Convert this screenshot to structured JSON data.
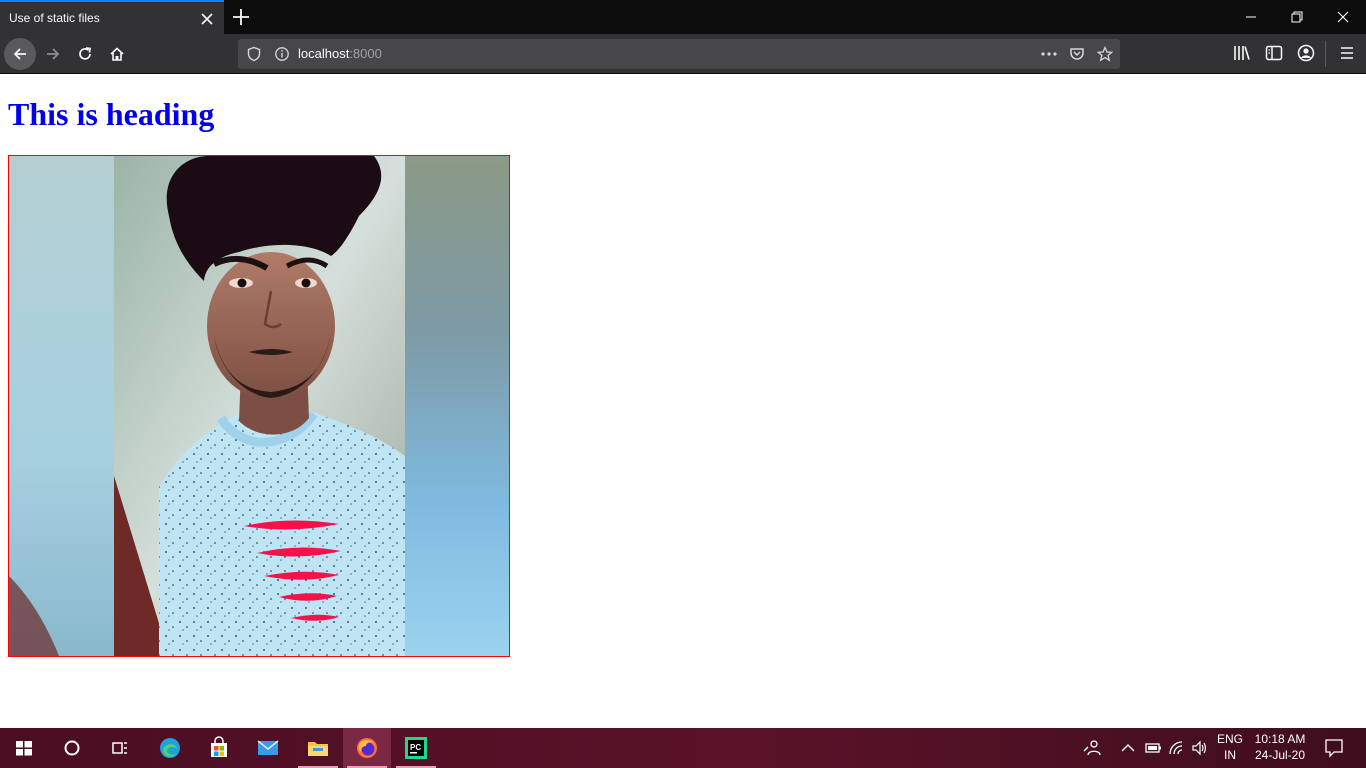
{
  "browser": {
    "tab_title": "Use of static files",
    "url_host": "localhost",
    "url_port": ":8000",
    "accent_color": "#0a84ff"
  },
  "page": {
    "heading": "This is heading",
    "heading_color": "#0000ee",
    "image_border_color": "#ff0000",
    "image_description_icon": "portrait-photo"
  },
  "taskbar": {
    "apps": [
      "start",
      "cortana-search",
      "task-view",
      "edge",
      "microsoft-store",
      "mail",
      "file-explorer",
      "firefox",
      "pycharm"
    ],
    "active_app": "firefox",
    "lang_line1": "ENG",
    "lang_line2": "IN",
    "time": "10:18 AM",
    "date": "24-Jul-20"
  }
}
